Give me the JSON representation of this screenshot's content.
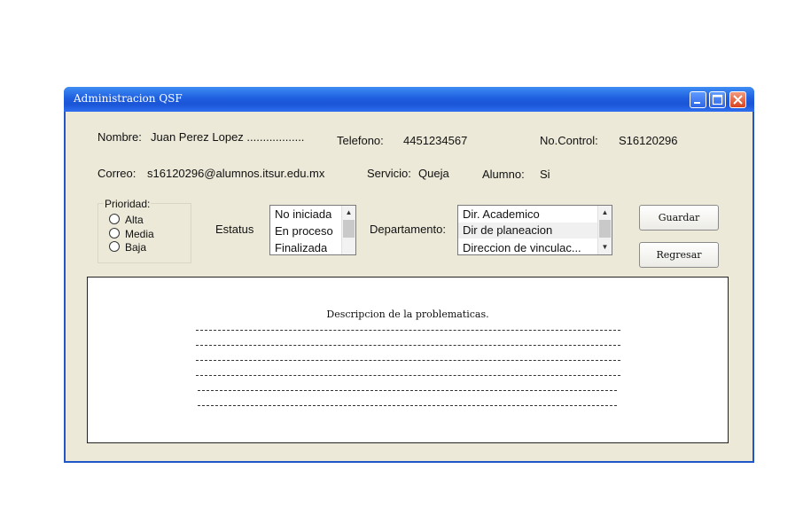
{
  "window": {
    "title": "Administracion QSF"
  },
  "fields": {
    "nombre_label": "Nombre:",
    "nombre_value": "Juan Perez Lopez ..................",
    "telefono_label": "Telefono:",
    "telefono_value": "4451234567",
    "nocontrol_label": "No.Control:",
    "nocontrol_value": "S16120296",
    "correo_label": "Correo:",
    "correo_value": "s16120296@alumnos.itsur.edu.mx",
    "servicio_label": "Servicio:",
    "servicio_value": "Queja",
    "alumno_label": "Alumno:",
    "alumno_value": "Si"
  },
  "prioridad": {
    "title": "Prioridad:",
    "options": [
      "Alta",
      "Media",
      "Baja"
    ]
  },
  "estatus": {
    "label": "Estatus",
    "items": [
      "No iniciada",
      "En proceso",
      "Finalizada"
    ]
  },
  "departamento": {
    "label": "Departamento:",
    "items": [
      "Dir. Academico",
      "Dir de planeacion",
      "Direccion de vinculac..."
    ]
  },
  "buttons": {
    "guardar": "Guardar",
    "regresar": "Regresar"
  },
  "descripcion": {
    "title": "Descripcion de la problematicas."
  },
  "icons": {
    "minimize": "minimize-icon",
    "maximize": "maximize-icon",
    "close": "close-icon",
    "scroll_up": "chevron-up-icon",
    "scroll_down": "chevron-down-icon"
  }
}
